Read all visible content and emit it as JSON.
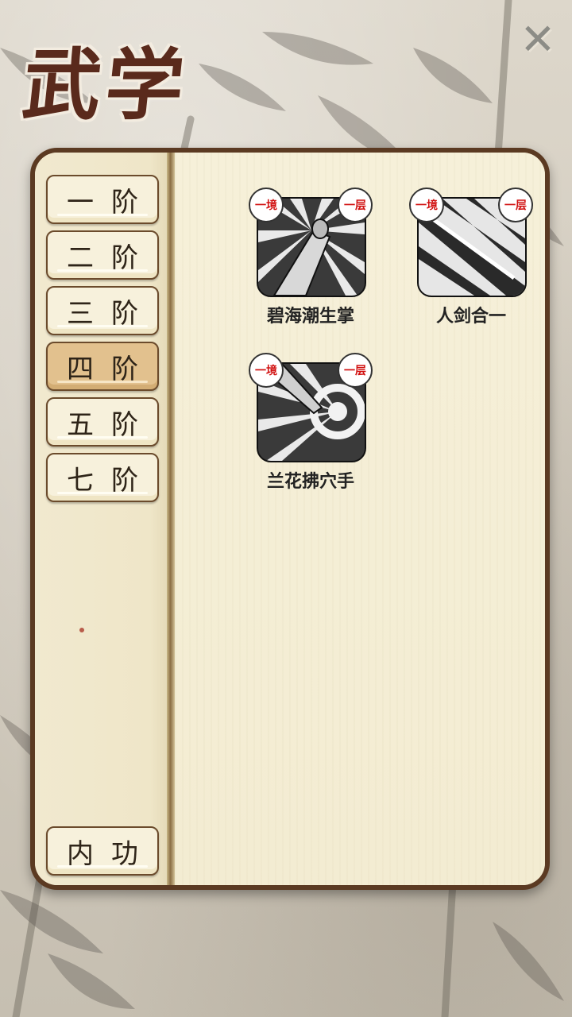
{
  "title": "武学",
  "close_label": "✕",
  "grades": [
    {
      "label": "一阶",
      "active": false
    },
    {
      "label": "二阶",
      "active": false
    },
    {
      "label": "三阶",
      "active": false
    },
    {
      "label": "四阶",
      "active": true
    },
    {
      "label": "五阶",
      "active": false
    },
    {
      "label": "七阶",
      "active": false
    }
  ],
  "inner_power_label": "内功",
  "skills": [
    {
      "name": "碧海潮生掌",
      "realm": "一境",
      "layer": "一层",
      "icon": "palm-icon"
    },
    {
      "name": "人剑合一",
      "realm": "一境",
      "layer": "一层",
      "icon": "sword-icon"
    },
    {
      "name": "兰花拂穴手",
      "realm": "一境",
      "layer": "一层",
      "icon": "finger-target-icon"
    }
  ],
  "colors": {
    "active_tab": "#e2c18e",
    "book_border": "#5b3a22",
    "tag_text": "#d11010"
  }
}
